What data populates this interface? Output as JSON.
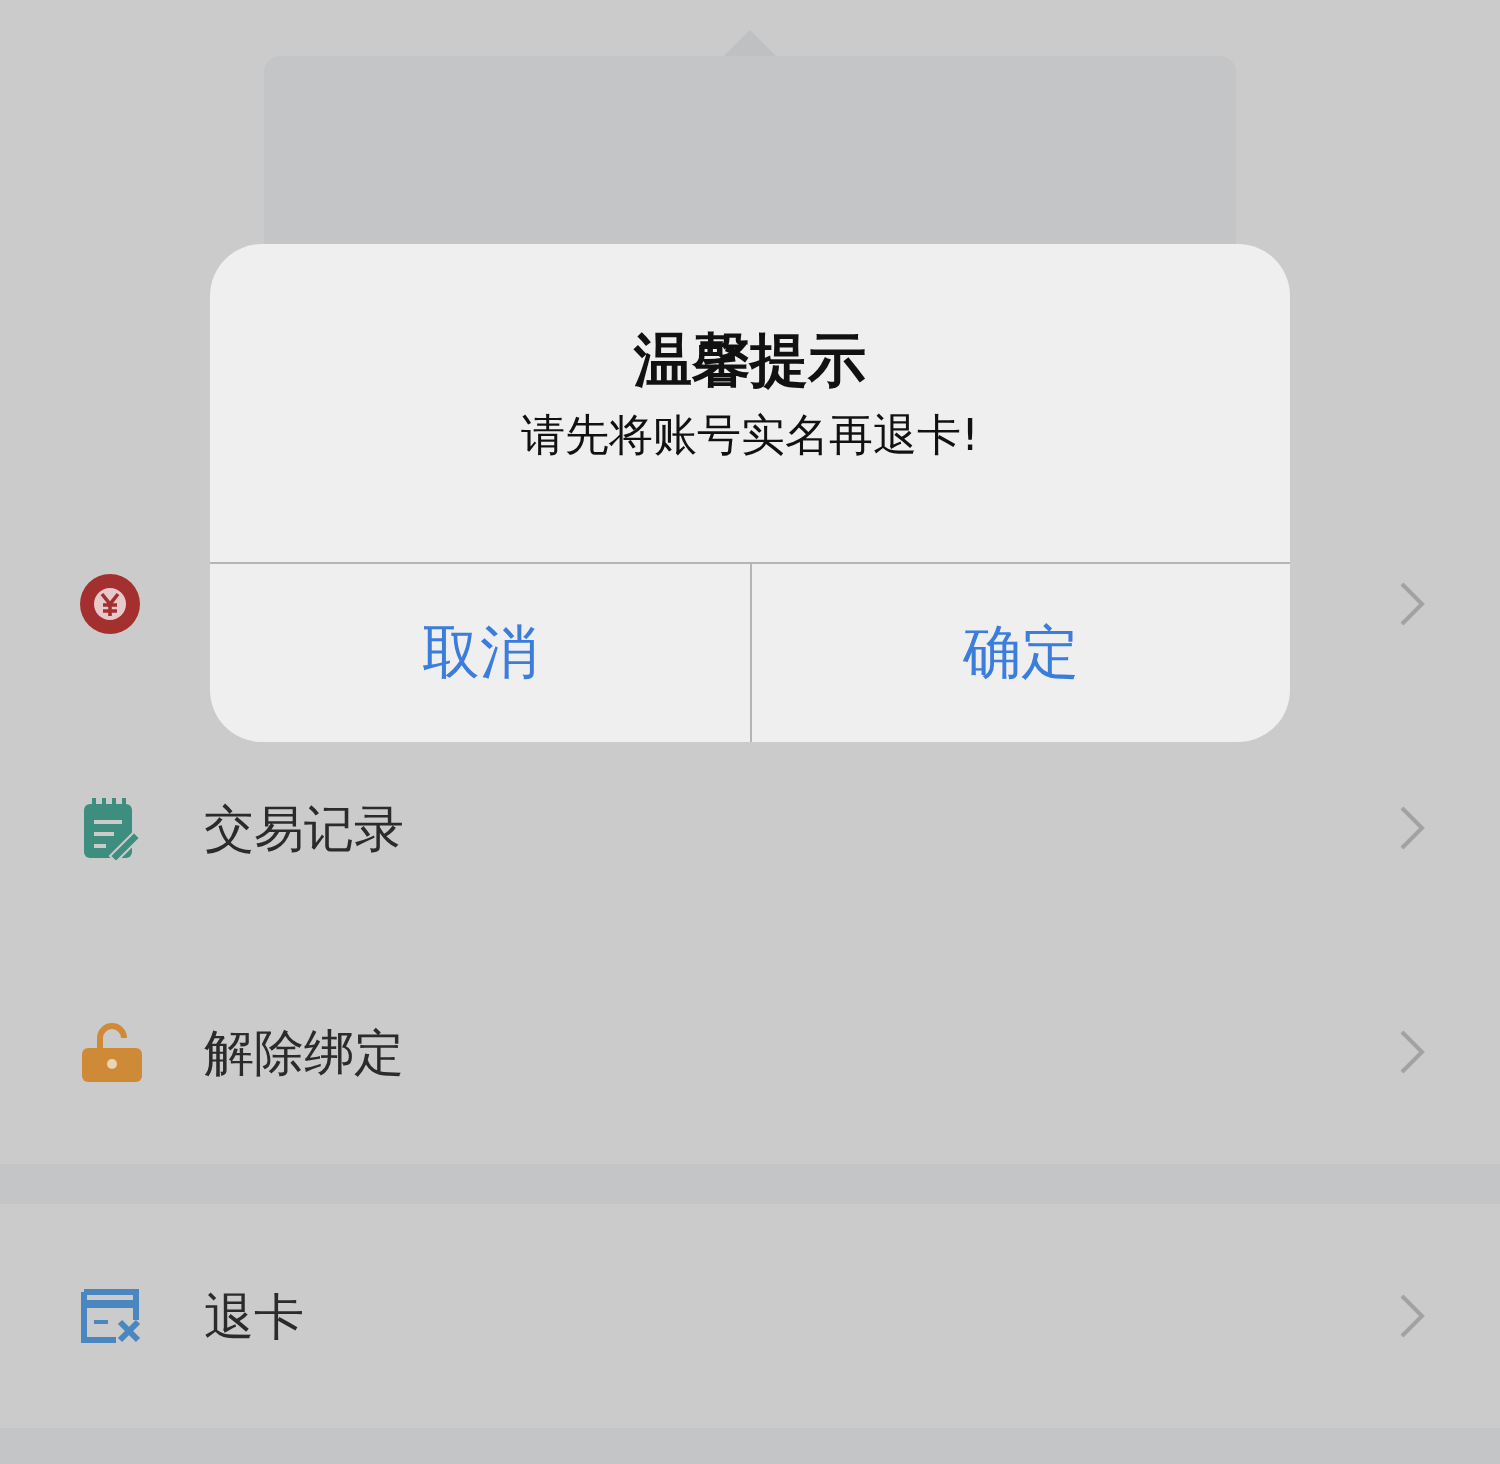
{
  "menu_sections": [
    {
      "rows": [
        {
          "kind": "covered"
        },
        {
          "kind": "item",
          "label": "交易记录"
        },
        {
          "kind": "item",
          "label": "解除绑定"
        }
      ]
    },
    {
      "rows": [
        {
          "kind": "item",
          "label": "退卡"
        }
      ]
    }
  ],
  "dialog": {
    "title": "温馨提示",
    "message": "请先将账号实名再退卡!",
    "buttons": [
      "取消",
      "确定"
    ]
  }
}
